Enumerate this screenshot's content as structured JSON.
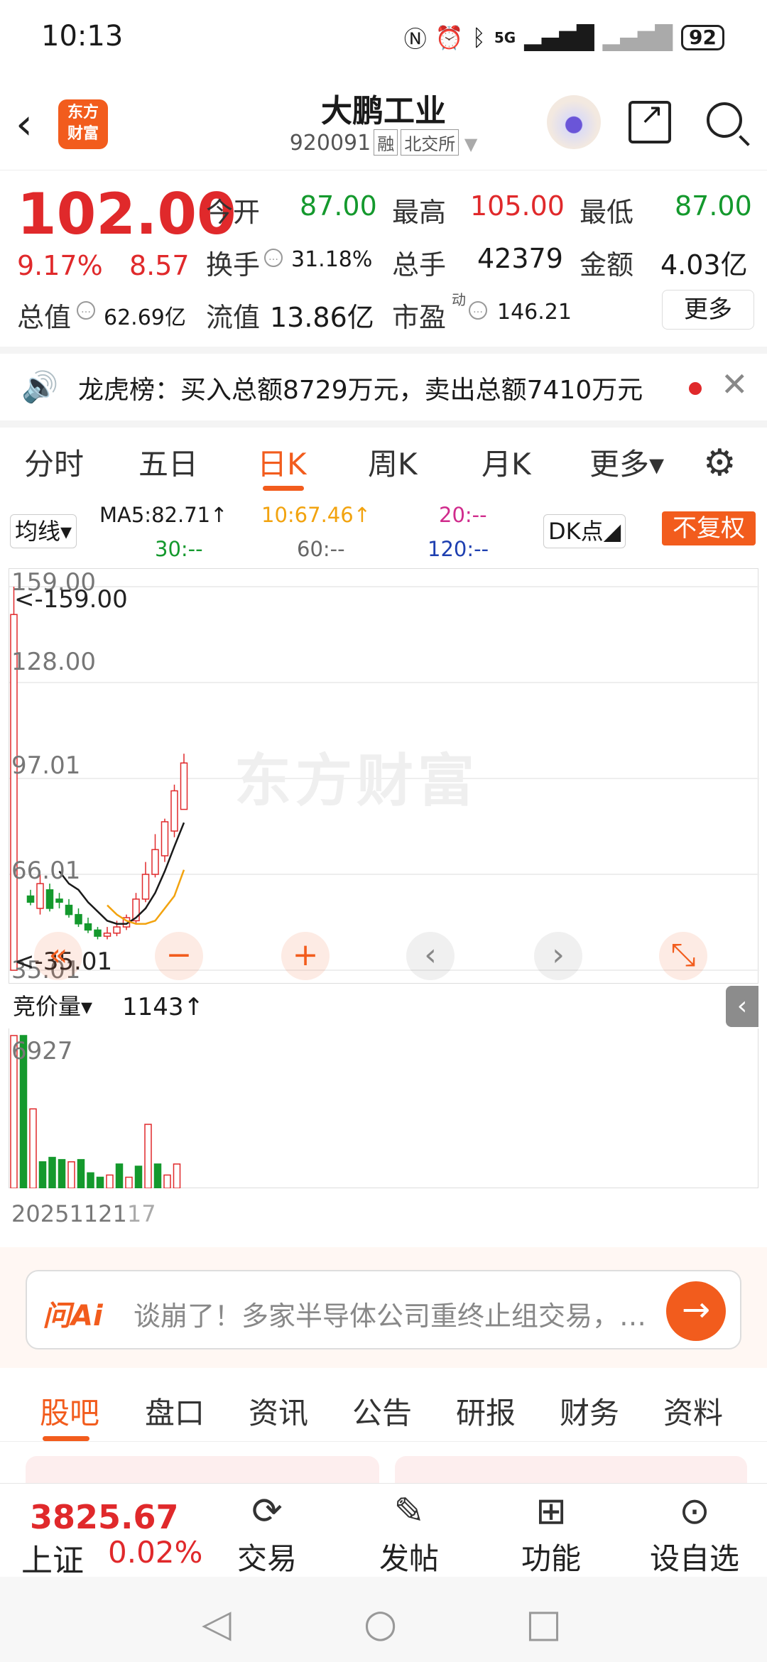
{
  "status_bar": {
    "time": "10:13",
    "network": "5G",
    "battery": "92"
  },
  "header": {
    "back": "‹",
    "logo": "东方\n财富",
    "title": "大鹏工业",
    "code": "920091",
    "tag_margin": "融",
    "tag_exchange": "北交所",
    "share_icon": "share-icon",
    "search_icon": "search-icon"
  },
  "quote": {
    "price": "102.00",
    "change_pct": "9.17%",
    "change": "8.57",
    "open_label": "今开",
    "open": "87.00",
    "high_label": "最高",
    "high": "105.00",
    "low_label": "最低",
    "low": "87.00",
    "turnover_label": "换手",
    "turnover": "31.18%",
    "volume_label": "总手",
    "volume": "42379",
    "amount_label": "金额",
    "amount": "4.03亿",
    "mcap_label": "总值",
    "mcap": "62.69亿",
    "float_label": "流值",
    "float": "13.86亿",
    "pe_label": "市盈",
    "pe_sup": "动",
    "pe": "146.21",
    "more": "更多"
  },
  "notice": {
    "text": "龙虎榜：买入总额8729万元，卖出总额7410万元",
    "close": "✕"
  },
  "tabs": [
    {
      "label": "分时"
    },
    {
      "label": "五日"
    },
    {
      "label": "日K"
    },
    {
      "label": "周K"
    },
    {
      "label": "月K"
    },
    {
      "label": "更多▾"
    }
  ],
  "ma": {
    "selector": "均线▾",
    "ma5": "MA5:82.71↑",
    "ma10": "10:67.46↑",
    "ma20": "20:--",
    "ma30": "30:--",
    "ma60": "60:--",
    "ma120": "120:--",
    "dk": "DK点◢",
    "adjust": "不复权"
  },
  "chart": {
    "y_top": "159.00",
    "y_top_marker": "<-159.00",
    "y2": "128.00",
    "y3": "97.01",
    "y4": "66.01",
    "y_bottom": "35.01",
    "y_bottom_marker": "<-35.01",
    "watermark": "东方财富",
    "vol_selector": "竞价量▾",
    "vol_value": "1143↑",
    "vol_max": "6927",
    "date_label": "20251121",
    "date_label2": "17",
    "colors": {
      "up": "#e0292b",
      "down": "#14992d",
      "ma5": "#1a1a1a",
      "ma10": "#f2a30f"
    }
  },
  "chart_data": {
    "type": "candlestick",
    "ylim": [
      35.01,
      159.0
    ],
    "candles": [
      {
        "open": 35,
        "close": 150,
        "high": 159,
        "low": 35
      },
      {
        "open": 59,
        "close": 57,
        "high": 61,
        "low": 56
      },
      {
        "open": 55,
        "close": 63,
        "high": 66,
        "low": 53
      },
      {
        "open": 61,
        "close": 55,
        "high": 63,
        "low": 54
      },
      {
        "open": 58,
        "close": 57,
        "high": 60,
        "low": 55
      },
      {
        "open": 56,
        "close": 53,
        "high": 58,
        "low": 52
      },
      {
        "open": 53,
        "close": 50,
        "high": 55,
        "low": 49
      },
      {
        "open": 50,
        "close": 48,
        "high": 52,
        "low": 47
      },
      {
        "open": 48,
        "close": 46,
        "high": 49,
        "low": 45
      },
      {
        "open": 46,
        "close": 47,
        "high": 49,
        "low": 45
      },
      {
        "open": 47,
        "close": 49,
        "high": 51,
        "low": 46
      },
      {
        "open": 49,
        "close": 52,
        "high": 53,
        "low": 48
      },
      {
        "open": 51,
        "close": 58,
        "high": 60,
        "low": 50
      },
      {
        "open": 58,
        "close": 66,
        "high": 70,
        "low": 57
      },
      {
        "open": 66,
        "close": 74,
        "high": 79,
        "low": 65
      },
      {
        "open": 72,
        "close": 83,
        "high": 84,
        "low": 70
      },
      {
        "open": 80,
        "close": 93,
        "high": 95,
        "low": 78
      },
      {
        "open": 87,
        "close": 102,
        "high": 105,
        "low": 87
      }
    ],
    "ma5": [
      null,
      null,
      null,
      null,
      67,
      63,
      61,
      57,
      54,
      51,
      50,
      50,
      52,
      55,
      60,
      67,
      75,
      82.71
    ],
    "ma10": [
      null,
      null,
      null,
      null,
      null,
      null,
      null,
      null,
      null,
      56,
      53,
      51,
      50,
      50,
      51,
      55,
      59,
      67.46
    ],
    "volume": [
      {
        "v": 6927,
        "up": true
      },
      {
        "v": 6927,
        "up": false
      },
      {
        "v": 3600,
        "up": true
      },
      {
        "v": 1200,
        "up": false
      },
      {
        "v": 1400,
        "up": false
      },
      {
        "v": 1300,
        "up": false
      },
      {
        "v": 1200,
        "up": true
      },
      {
        "v": 1300,
        "up": false
      },
      {
        "v": 700,
        "up": false
      },
      {
        "v": 500,
        "up": false
      },
      {
        "v": 600,
        "up": true
      },
      {
        "v": 1100,
        "up": false
      },
      {
        "v": 500,
        "up": true
      },
      {
        "v": 1000,
        "up": false
      },
      {
        "v": 2900,
        "up": true
      },
      {
        "v": 1100,
        "up": false
      },
      {
        "v": 600,
        "up": true
      },
      {
        "v": 1100,
        "up": true
      }
    ]
  },
  "ai": {
    "brand": "问Ai",
    "text": "谈崩了！多家半导体公司重终止组交易，这是怎么回事？"
  },
  "section_tabs": [
    {
      "label": "股吧"
    },
    {
      "label": "盘口"
    },
    {
      "label": "资讯"
    },
    {
      "label": "公告"
    },
    {
      "label": "研报"
    },
    {
      "label": "财务"
    },
    {
      "label": "资料"
    }
  ],
  "bottom": {
    "index_value": "3825.67",
    "index_name": "上证",
    "index_pct": "0.02%",
    "trade": "交易",
    "post": "发帖",
    "func": "功能",
    "watch": "设自选"
  }
}
